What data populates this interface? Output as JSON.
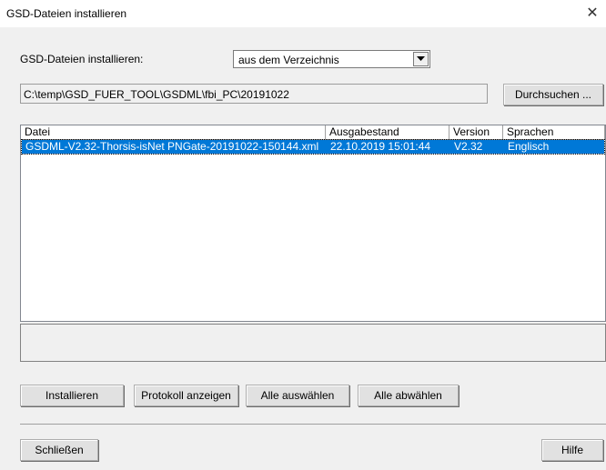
{
  "window": {
    "title": "GSD-Dateien installieren",
    "close_glyph": "✕"
  },
  "source": {
    "label": "GSD-Dateien installieren:",
    "selected": "aus dem Verzeichnis"
  },
  "path": {
    "value": "C:\\temp\\GSD_FUER_TOOL\\GSDML\\fbi_PC\\20191022"
  },
  "browse_button": "Durchsuchen ...",
  "table": {
    "columns": [
      "Datei",
      "Ausgabestand",
      "Version",
      "Sprachen"
    ],
    "rows": [
      {
        "datei": "GSDML-V2.32-Thorsis-isNet PNGate-20191022-150144.xml",
        "ausgabestand": "22.10.2019 15:01:44",
        "version": "V2.32",
        "sprachen": "Englisch",
        "selected": true
      }
    ]
  },
  "buttons": {
    "install": "Installieren",
    "show_log": "Protokoll anzeigen",
    "select_all": "Alle auswählen",
    "deselect_all": "Alle abwählen",
    "close": "Schließen",
    "help": "Hilfe"
  },
  "colors": {
    "selection": "#0078d7"
  }
}
